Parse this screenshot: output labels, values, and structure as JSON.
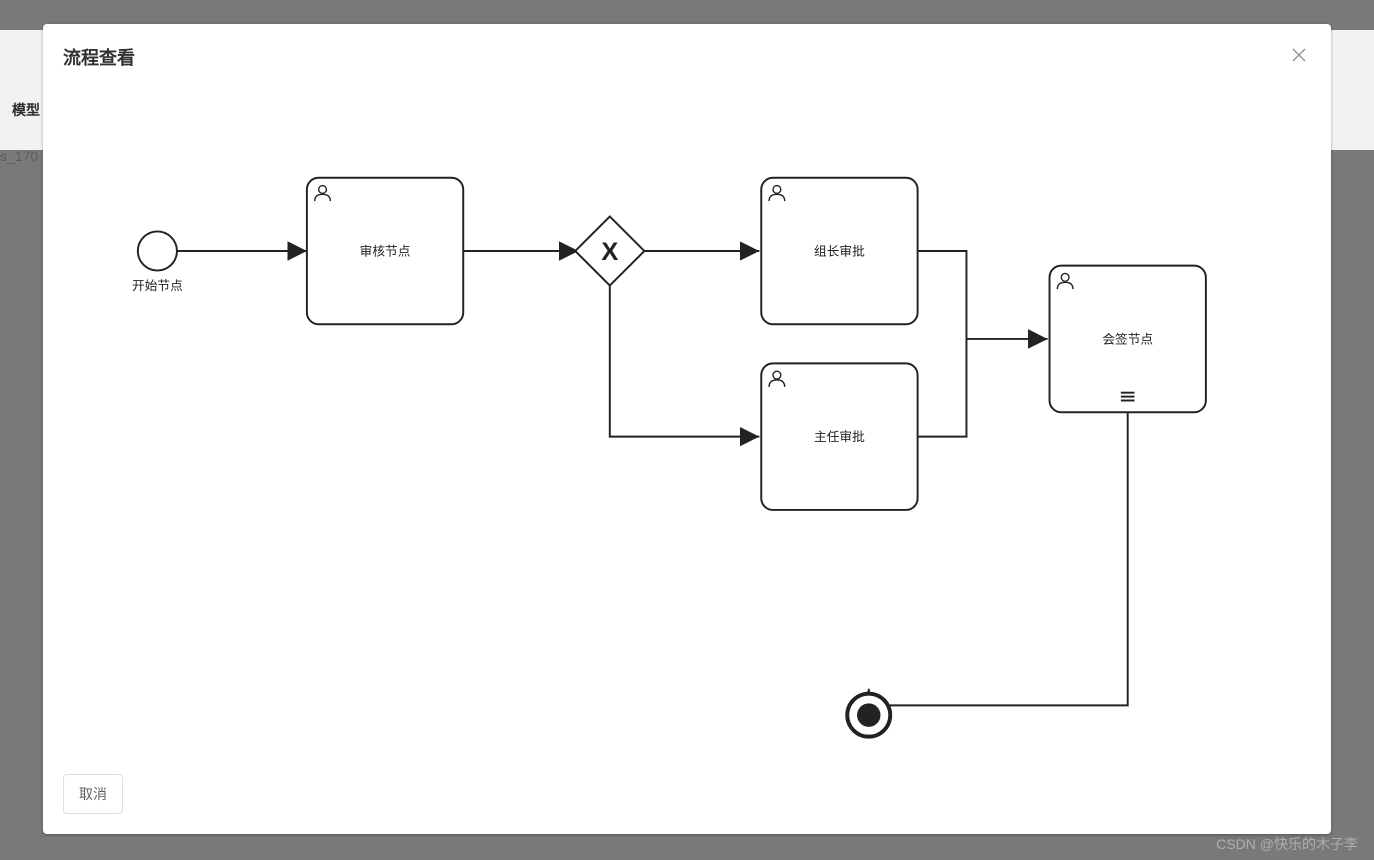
{
  "background": {
    "side_label1": "模型",
    "side_label2": "s_170"
  },
  "modal": {
    "title": "流程查看",
    "cancel_label": "取消"
  },
  "bpmn": {
    "start_label": "开始节点",
    "task1_label": "审核节点",
    "task2_label": "组长审批",
    "task3_label": "主任审批",
    "task4_label": "会签节点",
    "gateway_symbol": "X"
  },
  "watermark": "CSDN @快乐的木子李"
}
